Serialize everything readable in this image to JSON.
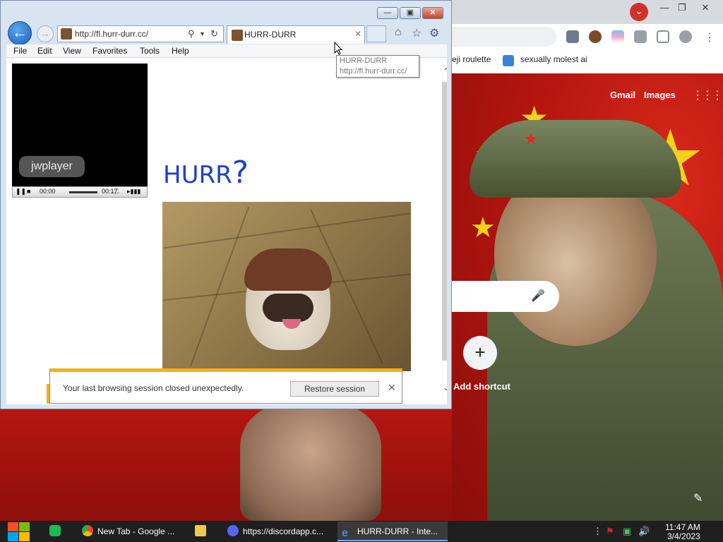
{
  "chrome": {
    "bookmarks": [
      "eji roulette",
      "sexually molest ai"
    ],
    "links": {
      "gmail": "Gmail",
      "images": "Images"
    },
    "add_shortcut": "Add shortcut"
  },
  "ie": {
    "address_url": "http://fl.hurr-durr.cc/",
    "tab_title": "HURR-DURR",
    "menu": [
      "File",
      "Edit",
      "View",
      "Favorites",
      "Tools",
      "Help"
    ],
    "tooltip": {
      "title": "HURR-DURR",
      "url": "http://fl.hurr-durr.cc/"
    },
    "page": {
      "player_logo": "jwplayer",
      "time_current": "00:00",
      "time_total": "00:17",
      "heading": "HURR",
      "heading_mark": "?"
    },
    "notification": {
      "message": "Your last browsing session closed unexpectedly.",
      "restore_label": "Restore session"
    }
  },
  "taskbar": {
    "apps": [
      {
        "label": "New Tab - Google ...",
        "icon": "chrome-icon"
      },
      {
        "label": "",
        "icon": "folder-icon"
      },
      {
        "label": "https://discordapp.c...",
        "icon": "discord-icon"
      },
      {
        "label": "HURR-DURR - Inte...",
        "icon": "ie-icon"
      }
    ],
    "clock": {
      "time": "11:47 AM",
      "date": "3/4/2023"
    }
  },
  "colors": {
    "accent": "#1f3fcf",
    "notif_bar": "#f2b01e",
    "chrome_profile": "#d2312b"
  }
}
